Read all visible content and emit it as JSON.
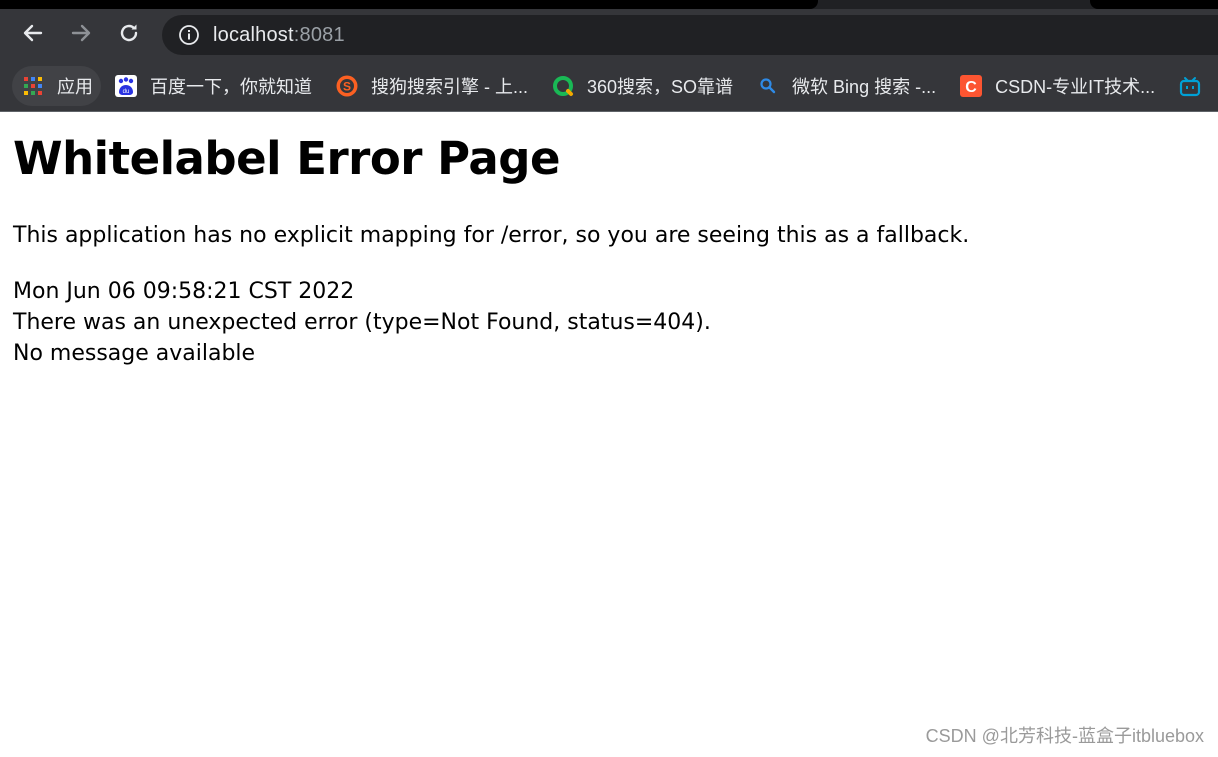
{
  "browser": {
    "url_host": "localhost",
    "url_port": ":8081",
    "bookmarks": [
      {
        "label": "应用",
        "icon": "apps-grid-icon"
      },
      {
        "label": "百度一下，你就知道",
        "icon": "baidu-icon"
      },
      {
        "label": "搜狗搜索引擎 - 上...",
        "icon": "sogou-icon"
      },
      {
        "label": "360搜索，SO靠谱",
        "icon": "so360-icon"
      },
      {
        "label": "微软 Bing 搜索 -...",
        "icon": "bing-search-icon"
      },
      {
        "label": "CSDN-专业IT技术...",
        "icon": "csdn-icon"
      }
    ],
    "colors": {
      "frame": "#35363a",
      "omnibox": "#202124",
      "text": "#e8eaed"
    }
  },
  "page": {
    "title": "Whitelabel Error Page",
    "message": "This application has no explicit mapping for /error, so you are seeing this as a fallback.",
    "timestamp": "Mon Jun 06 09:58:21 CST 2022",
    "error_line": "There was an unexpected error (type=Not Found, status=404).",
    "detail": "No message available"
  },
  "watermark": "CSDN @北芳科技-蓝盒子itbluebox"
}
